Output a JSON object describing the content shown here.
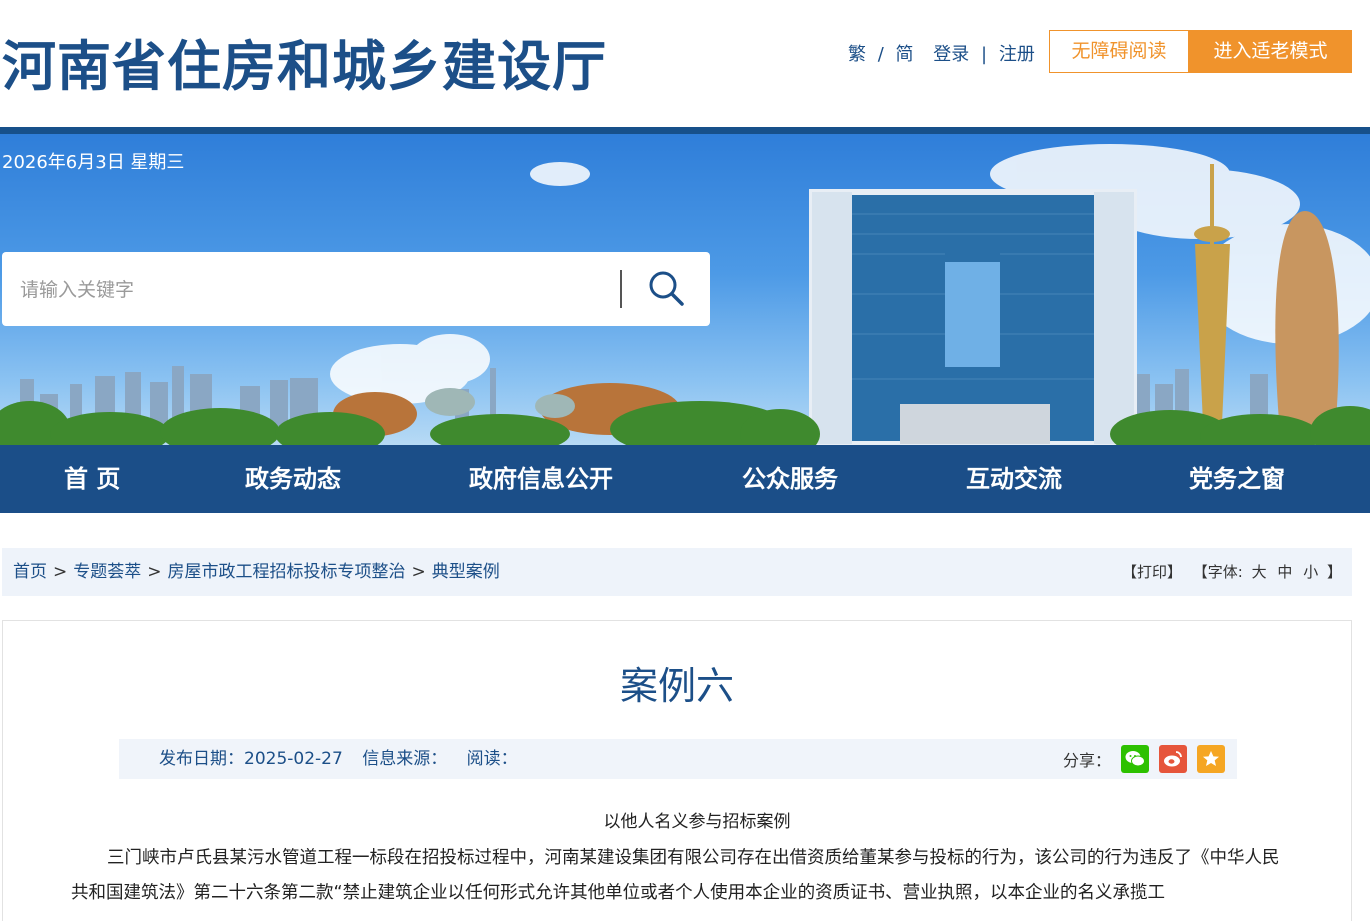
{
  "header": {
    "site_title": "河南省住房和城乡建设厅",
    "lang_traditional": "繁",
    "lang_sep": "/",
    "lang_simplified": "简",
    "login": "登录",
    "auth_sep": "|",
    "register": "注册",
    "accessible_btn": "无障碍阅读",
    "elder_btn": "进入适老模式"
  },
  "banner": {
    "date": "2026年6月3日 星期三",
    "search_placeholder": "请输入关键字"
  },
  "nav": {
    "items": [
      "首 页",
      "政务动态",
      "政府信息公开",
      "公众服务",
      "互动交流",
      "党务之窗"
    ]
  },
  "breadcrumb": {
    "items": [
      "首页",
      "专题荟萃",
      "房屋市政工程招标投标专项整治",
      "典型案例"
    ],
    "separator": ">",
    "print": "【打印】",
    "font_label": "【字体:",
    "font_large": "大",
    "font_medium": "中",
    "font_small": "小",
    "font_close": "】"
  },
  "article": {
    "title": "案例六",
    "publish_date": "发布日期：2025-02-27",
    "source": "信息来源：",
    "reads": "阅读：",
    "share_label": "分享：",
    "subtitle": "以他人名义参与招标案例",
    "body": "三门峡市卢氏县某污水管道工程一标段在招投标过程中，河南某建设集团有限公司存在出借资质给董某参与投标的行为，该公司的行为违反了《中华人民共和国建筑法》第二十六条第二款“禁止建筑企业以任何形式允许其他单位或者个人使用本企业的资质证书、营业执照，以本企业的名义承揽工"
  },
  "colors": {
    "brand_blue": "#1b4e88",
    "orange": "#f0932c",
    "wechat": "#2dc100",
    "weibo": "#e6553b",
    "favorite": "#f5a623"
  }
}
